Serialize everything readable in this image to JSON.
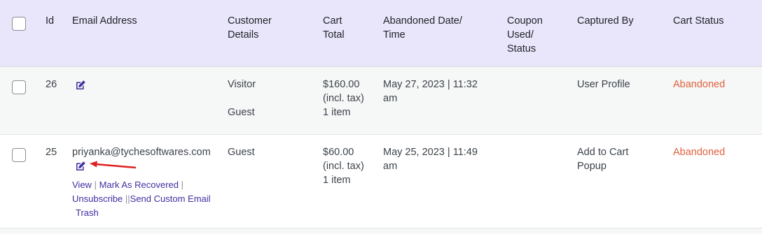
{
  "header": {
    "id": "Id",
    "email": "Email Address",
    "customer_l1": "Customer",
    "customer_l2": "Details",
    "cart_total_l1": "Cart",
    "cart_total_l2": "Total",
    "abandoned_l1": "Abandoned Date/",
    "abandoned_l2": "Time",
    "coupon_l1": "Coupon",
    "coupon_l2": "Used/",
    "coupon_l3": "Status",
    "captured_by": "Captured By",
    "cart_status": "Cart Status"
  },
  "rows": [
    {
      "id": "26",
      "email": "",
      "customer_l1": "Visitor",
      "customer_l2": "Guest",
      "total_l1": "$160.00",
      "total_l2": "(incl. tax)",
      "total_l3": "1 item",
      "date_l1": "May 27, 2023 | 11:32",
      "date_l2": "am",
      "captured_by_l1": "User Profile",
      "captured_by_l2": "",
      "status": "Abandoned"
    },
    {
      "id": "25",
      "email": "priyanka@tychesoftwares.com",
      "customer_l1": "Guest",
      "total_l1": "$60.00",
      "total_l2": "(incl. tax)",
      "total_l3": "1 item",
      "date_l1": "May 25, 2023 | 11:49",
      "date_l2": "am",
      "captured_by_l1": "Add to Cart",
      "captured_by_l2": "Popup",
      "status": "Abandoned",
      "actions": {
        "view": "View",
        "mark_recovered": "Mark As Recovered",
        "unsubscribe": "Unsubscribe",
        "send_email": "Send Custom Email",
        "trash": "Trash"
      }
    }
  ],
  "colors": {
    "header_bg": "#e9e5fb",
    "status": "#e0613d",
    "link": "#3f2fa0",
    "arrow": "#e02020"
  },
  "icons": [
    "edit-icon",
    "arrow-pointer"
  ]
}
